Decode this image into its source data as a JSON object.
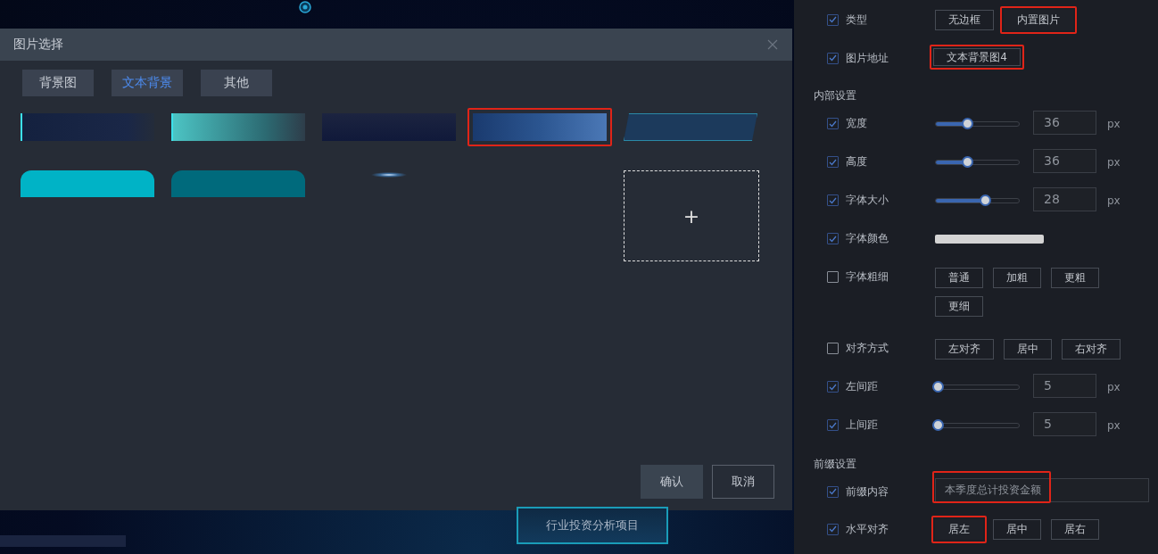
{
  "canvas": {
    "banner": "行业投资分析项目"
  },
  "dialog": {
    "title": "图片选择",
    "tabs": [
      {
        "label": "背景图",
        "selected": false
      },
      {
        "label": "文本背景",
        "selected": true
      },
      {
        "label": "其他",
        "selected": false
      }
    ],
    "thumbnails": [
      {
        "kind": "accent-dark",
        "selected": false
      },
      {
        "kind": "accent-teal",
        "selected": false
      },
      {
        "kind": "fade",
        "selected": false
      },
      {
        "kind": "blue",
        "selected": true
      },
      {
        "kind": "slanted",
        "selected": false
      },
      {
        "kind": "tab-cyan",
        "selected": false
      },
      {
        "kind": "tab-teal",
        "selected": false
      },
      {
        "kind": "glow",
        "selected": false
      }
    ],
    "add_tile": {
      "label": "+"
    },
    "buttons": [
      {
        "label": "确认",
        "kind": "primary"
      },
      {
        "label": "取消",
        "kind": "secondary"
      }
    ]
  },
  "panel": {
    "rows": [
      {
        "kind": "options",
        "label": "类型",
        "checked": true,
        "options": [
          {
            "label": "无边框",
            "selected": false,
            "highlighted": false
          },
          {
            "label": "内置图片",
            "selected": true,
            "highlighted": true
          }
        ]
      },
      {
        "kind": "value",
        "label": "图片地址",
        "checked": true,
        "value": "文本背景图4",
        "highlighted": true
      },
      {
        "kind": "section",
        "label": "内部设置"
      },
      {
        "kind": "slider",
        "label": "宽度",
        "checked": true,
        "level": 0.35,
        "value": "36",
        "unit": "px"
      },
      {
        "kind": "slider",
        "label": "高度",
        "checked": true,
        "level": 0.35,
        "value": "36",
        "unit": "px"
      },
      {
        "kind": "slider",
        "label": "字体大小",
        "checked": true,
        "level": 0.57,
        "value": "28",
        "unit": "px"
      },
      {
        "kind": "color",
        "label": "字体颜色",
        "checked": true,
        "color": "#d4d4d4"
      },
      {
        "kind": "options",
        "label": "字体粗细",
        "checked": false,
        "options": [
          {
            "label": "普通",
            "selected": false,
            "highlighted": false
          },
          {
            "label": "加粗",
            "selected": false,
            "highlighted": false
          },
          {
            "label": "更粗",
            "selected": false,
            "highlighted": false
          },
          {
            "label": "更细",
            "selected": false,
            "highlighted": false
          }
        ]
      },
      {
        "kind": "options",
        "label": "对齐方式",
        "checked": false,
        "options": [
          {
            "label": "左对齐",
            "selected": false,
            "highlighted": false
          },
          {
            "label": "居中",
            "selected": false,
            "highlighted": false
          },
          {
            "label": "右对齐",
            "selected": false,
            "highlighted": false
          }
        ]
      },
      {
        "kind": "slider",
        "label": "左间距",
        "checked": true,
        "level": 0.0,
        "value": "5",
        "unit": "px"
      },
      {
        "kind": "slider",
        "label": "上间距",
        "checked": true,
        "level": 0.0,
        "value": "5",
        "unit": "px"
      },
      {
        "kind": "section",
        "label": "前缀设置"
      },
      {
        "kind": "text",
        "label": "前缀内容",
        "checked": true,
        "value": "本季度总计投资金额",
        "highlighted": true
      },
      {
        "kind": "options",
        "label": "水平对齐",
        "checked": true,
        "options": [
          {
            "label": "居左",
            "selected": true,
            "highlighted": true
          },
          {
            "label": "居中",
            "selected": false,
            "highlighted": false
          },
          {
            "label": "居右",
            "selected": false,
            "highlighted": false
          }
        ]
      }
    ]
  }
}
